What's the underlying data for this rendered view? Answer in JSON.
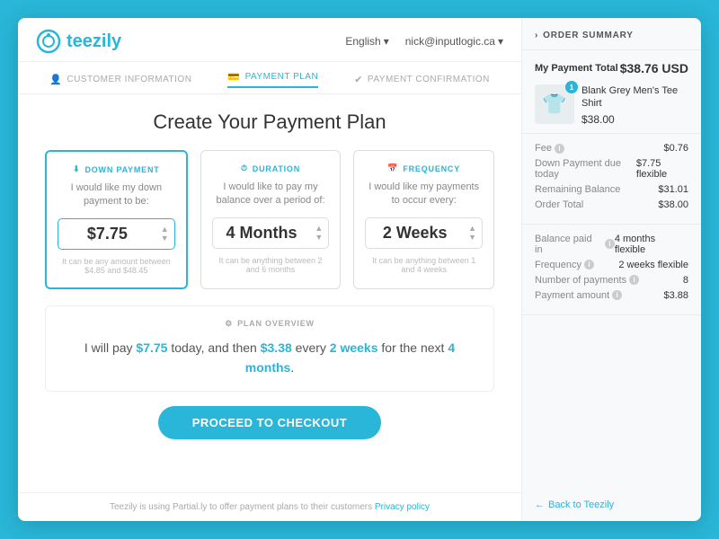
{
  "header": {
    "logo_text": "teezily",
    "lang": "English",
    "lang_arrow": "▾",
    "user": "nick@inputlogic.ca",
    "user_arrow": "▾"
  },
  "steps": [
    {
      "id": "customer-info",
      "label": "Customer Information",
      "icon": "👤",
      "active": false
    },
    {
      "id": "payment-plan",
      "label": "Payment Plan",
      "icon": "💳",
      "active": true
    },
    {
      "id": "payment-confirmation",
      "label": "Payment Confirmation",
      "icon": "✔",
      "active": false
    }
  ],
  "page_title": "Create Your Payment Plan",
  "cards": [
    {
      "id": "down-payment",
      "header": "Down Payment",
      "desc": "I would like my down payment to be:",
      "value": "$7.75",
      "hint": "It can be any amount between $4.85 and $48.45",
      "active": true
    },
    {
      "id": "duration",
      "header": "Duration",
      "desc": "I would like to pay my balance over a period of:",
      "value": "4 Months",
      "hint": "It can be anything between 2 and 6 months",
      "active": false
    },
    {
      "id": "frequency",
      "header": "Frequency",
      "desc": "I would like my payments to occur every:",
      "value": "2 Weeks",
      "hint": "It can be anything between 1 and 4 weeks",
      "active": false
    }
  ],
  "plan_overview": {
    "header": "Plan Overview",
    "text_parts": {
      "intro": "I will pay ",
      "today_amount": "$7.75",
      "today_label": " today, and then ",
      "recurring_amount": "$3.38",
      "recurring_label": " every ",
      "frequency": "2 weeks",
      "tail": " for the next ",
      "duration": "4 months",
      "end": "."
    }
  },
  "checkout_button": "Proceed to Checkout",
  "footer": {
    "text": "Teezily is using Partial.ly to offer payment plans to their customers",
    "link": "Privacy policy"
  },
  "sidebar": {
    "header": "Order Summary",
    "total_label": "My Payment Total",
    "total_value": "$38.76 USD",
    "product": {
      "name": "Blank Grey Men's Tee Shirt",
      "price": "$38.00",
      "badge": "1"
    },
    "fees": [
      {
        "label": "Fee",
        "value": "$0.76"
      },
      {
        "label": "Down Payment due today",
        "value": "$7.75 flexible"
      },
      {
        "label": "Remaining Balance",
        "value": "$31.01"
      },
      {
        "label": "Order Total",
        "value": "$38.00"
      }
    ],
    "info_rows": [
      {
        "label": "Balance paid in",
        "value": "4 months flexible"
      },
      {
        "label": "Frequency",
        "value": "2 weeks flexible"
      },
      {
        "label": "Number of payments",
        "value": "8"
      },
      {
        "label": "Payment amount",
        "value": "$3.88"
      }
    ],
    "back_link": "← Back to Teezily"
  }
}
